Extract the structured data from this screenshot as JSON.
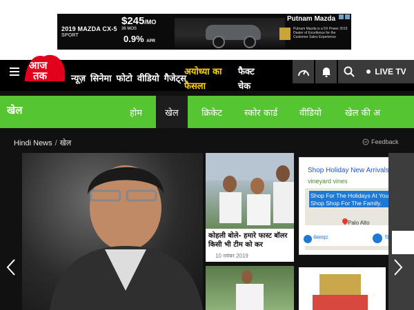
{
  "ad": {
    "model": "2019 MAZDA CX-5",
    "trim": "SPORT",
    "price": "$245",
    "price_per": "/MO",
    "price_term": "36 MOS",
    "apr": "0.9%",
    "apr_sub": "APR",
    "dealer": "Putnam Mazda",
    "dealer_sub": "Putnam Mazda is a 5X Power 2019 Dealer of Excellence for the Customer Sales Experience"
  },
  "header": {
    "logo_alt": "आज तक",
    "nav": [
      "न्यूज़",
      "सिनेमा",
      "फोटो",
      "वीडियो",
      "गैजेट्स"
    ],
    "highlight": "अयोध्या का फैसला",
    "fact": "फैक्ट चेक",
    "live": "LIVE TV",
    "icons": [
      "speedometer-icon",
      "bell-icon",
      "search-icon"
    ]
  },
  "section": {
    "title": "खेल",
    "tabs": [
      "होम",
      "खेल",
      "क्रिकेट",
      "स्कोर कार्ड",
      "वीडियो",
      "खेल की अ"
    ],
    "active_tab": 1
  },
  "breadcrumb": {
    "home": "Hindi News",
    "separator": "/",
    "current": "खेल"
  },
  "feedback": "Feedback",
  "cards": [
    {
      "title": "कोहली बोले- हमारे फास्ट बॉलर किसी भी टीम को कर",
      "date": "10 नवंबर 2019"
    }
  ],
  "google_ad": {
    "title": "Shop Holiday New Arrivals",
    "url": "vineyard vines",
    "box_text": "Shop For The Holidays At Your Shop Shop For The Family.",
    "city": "Palo Alto",
    "btn1": "वेबसाइट",
    "btn2": "दि"
  },
  "colors": {
    "brand_red": "#e3001b",
    "section_green": "#56c532",
    "highlight_yellow": "#ffd400"
  }
}
